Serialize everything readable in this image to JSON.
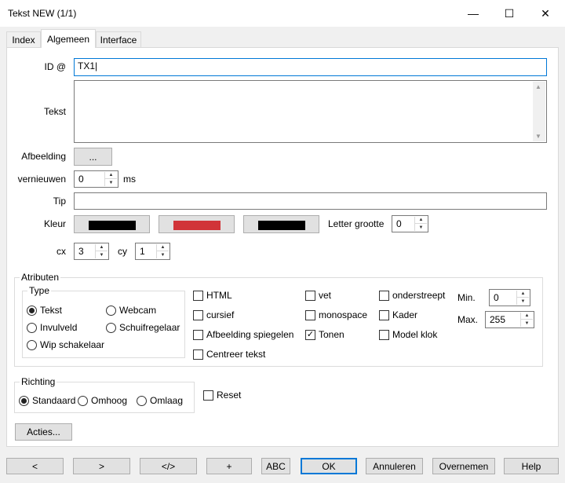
{
  "window": {
    "title": "Tekst NEW (1/1)",
    "minimize": "—",
    "maximize": "☐",
    "close": "✕"
  },
  "tabs": [
    {
      "label": "Index"
    },
    {
      "label": "Algemeen"
    },
    {
      "label": "Interface"
    }
  ],
  "fields": {
    "id_label": "ID @",
    "id_value": "TX1",
    "tekst_label": "Tekst",
    "tekst_value": "",
    "afbeelding_label": "Afbeelding",
    "afbeelding_button": "...",
    "vernieuwen_label": "vernieuwen",
    "vernieuwen_value": "0",
    "vernieuwen_unit": "ms",
    "tip_label": "Tip",
    "tip_value": "",
    "kleur_label": "Kleur",
    "kleur_colors": [
      "#000000",
      "#d13438",
      "#000000"
    ],
    "letter_grootte_label": "Letter grootte",
    "letter_grootte_value": "0",
    "cx_label": "cx",
    "cx_value": "3",
    "cy_label": "cy",
    "cy_value": "1"
  },
  "attributen": {
    "title": "Atributen",
    "type_title": "Type",
    "types": [
      {
        "label": "Tekst",
        "selected": true
      },
      {
        "label": "Webcam",
        "selected": false
      },
      {
        "label": "Invulveld",
        "selected": false
      },
      {
        "label": "Schuifregelaar",
        "selected": false
      },
      {
        "label": "Wip schakelaar",
        "selected": false
      }
    ],
    "checks": [
      {
        "label": "HTML",
        "checked": false
      },
      {
        "label": "cursief",
        "checked": false
      },
      {
        "label": "Afbeelding spiegelen",
        "checked": false
      },
      {
        "label": "Centreer tekst",
        "checked": false
      },
      {
        "label": "vet",
        "checked": false
      },
      {
        "label": "monospace",
        "checked": false
      },
      {
        "label": "Tonen",
        "checked": true
      },
      {
        "label": "onderstreept",
        "checked": false
      },
      {
        "label": "Kader",
        "checked": false
      },
      {
        "label": "Model klok",
        "checked": false
      }
    ],
    "min_label": "Min.",
    "min_value": "0",
    "max_label": "Max.",
    "max_value": "255"
  },
  "richting": {
    "title": "Richting",
    "options": [
      {
        "label": "Standaard",
        "selected": true
      },
      {
        "label": "Omhoog",
        "selected": false
      },
      {
        "label": "Omlaag",
        "selected": false
      }
    ]
  },
  "reset_label": "Reset",
  "acties_button": "Acties...",
  "footer": {
    "buttons": [
      "<",
      ">",
      "</>",
      "+",
      "ABC",
      "OK",
      "Annuleren",
      "Overnemen",
      "Help"
    ]
  }
}
